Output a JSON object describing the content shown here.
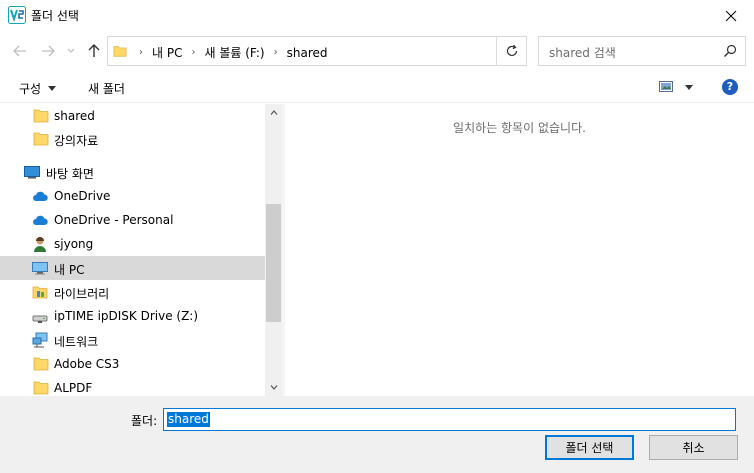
{
  "window": {
    "title": "폴더 선택"
  },
  "address": {
    "segments": [
      "내 PC",
      "새 볼륨 (F:)",
      "shared"
    ]
  },
  "search": {
    "placeholder": "shared 검색"
  },
  "toolbar": {
    "organize": "구성",
    "new_folder": "새 폴더"
  },
  "navpane": {
    "items": [
      {
        "label": "shared",
        "icon": "folder-icon"
      },
      {
        "label": "강의자료",
        "icon": "folder-icon"
      },
      {
        "label": "바탕 화면",
        "icon": "desktop-icon"
      },
      {
        "label": "OneDrive",
        "icon": "cloud-icon"
      },
      {
        "label": "OneDrive - Personal",
        "icon": "cloud-icon"
      },
      {
        "label": "sjyong",
        "icon": "user-icon"
      },
      {
        "label": "내 PC",
        "icon": "computer-icon"
      },
      {
        "label": "라이브러리",
        "icon": "library-icon"
      },
      {
        "label": "ipTIME ipDISK Drive (Z:)",
        "icon": "network-drive-icon"
      },
      {
        "label": "네트워크",
        "icon": "network-icon"
      },
      {
        "label": "Adobe CS3",
        "icon": "folder-icon"
      },
      {
        "label": "ALPDF",
        "icon": "folder-icon"
      }
    ],
    "selected": "내 PC"
  },
  "content": {
    "empty_message": "일치하는 항목이 없습니다."
  },
  "footer": {
    "folder_label": "폴더:",
    "folder_value": "shared",
    "select_button": "폴더 선택",
    "cancel_button": "취소"
  },
  "colors": {
    "accent": "#0078d7",
    "folder": "#ffd766",
    "selection": "#d9d9d9"
  }
}
